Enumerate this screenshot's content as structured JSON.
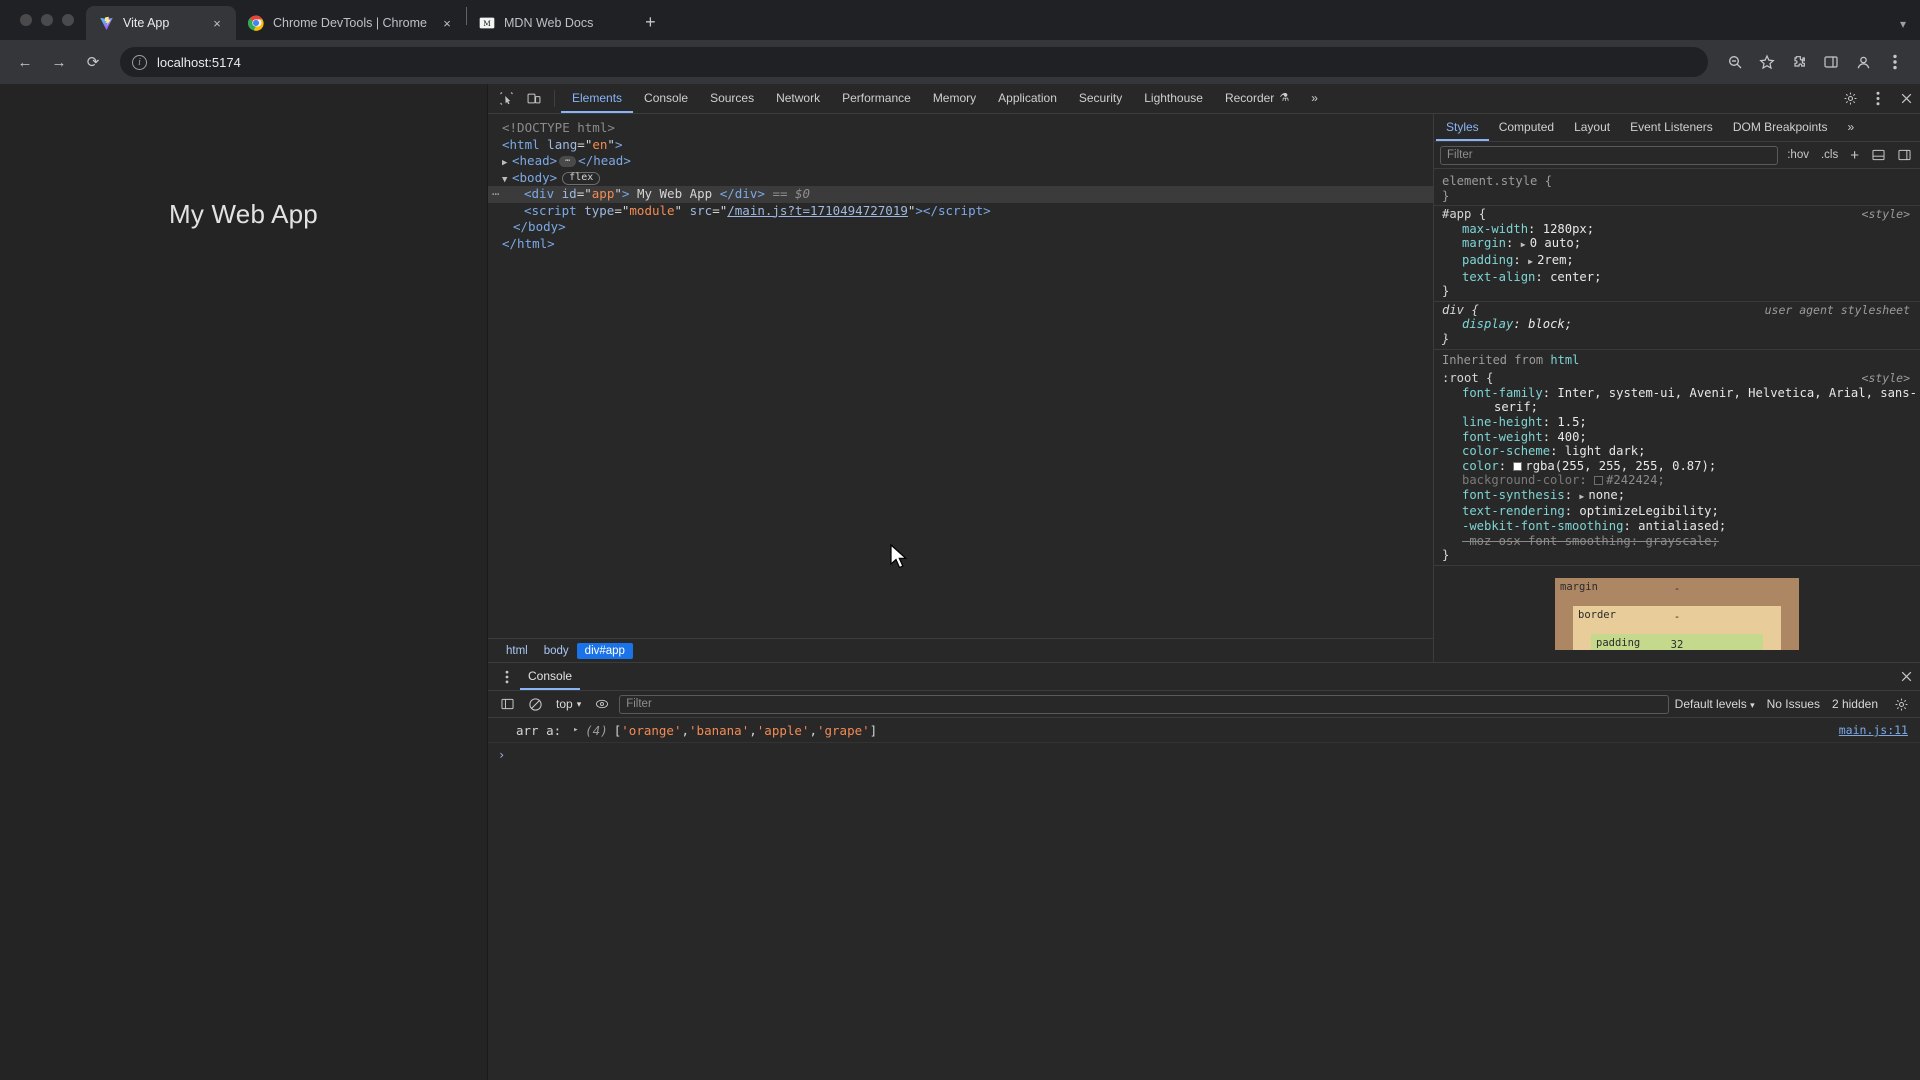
{
  "browser": {
    "tabs": [
      {
        "title": "Vite App",
        "favicon": "vite-logo-icon",
        "active": true,
        "close": "×"
      },
      {
        "title": "Chrome DevTools | Chrome f",
        "favicon": "chrome-logo-icon",
        "active": false,
        "close": "×"
      },
      {
        "title": "MDN Web Docs",
        "favicon": "mdn-logo-icon",
        "active": false,
        "close": ""
      }
    ],
    "new_tab_label": "+",
    "nav": {
      "back": "←",
      "forward": "→",
      "reload": "⟳"
    },
    "omnibox": {
      "value": "localhost:5174",
      "info_icon": "site-info-icon"
    },
    "toolbar_icons": [
      "zoom-icon",
      "bookmark-star-icon",
      "extensions-icon",
      "side-panel-icon",
      "profile-icon",
      "browser-menu-icon"
    ]
  },
  "page": {
    "heading": "My Web App"
  },
  "devtools": {
    "panel_tabs": [
      {
        "label": "Elements",
        "active": true
      },
      {
        "label": "Console",
        "active": false
      },
      {
        "label": "Sources",
        "active": false
      },
      {
        "label": "Network",
        "active": false
      },
      {
        "label": "Performance",
        "active": false
      },
      {
        "label": "Memory",
        "active": false
      },
      {
        "label": "Application",
        "active": false
      },
      {
        "label": "Security",
        "active": false
      },
      {
        "label": "Lighthouse",
        "active": false
      },
      {
        "label": "Recorder",
        "active": false,
        "suffix": "⚗"
      }
    ],
    "more_tabs": "»",
    "settings_icon": "gear-icon",
    "menu_icon": "kebab-menu-icon",
    "close_icon": "close-icon",
    "inspect_icon": "inspect-element-icon",
    "device_icon": "device-toolbar-icon",
    "dom": {
      "lines": [
        {
          "type": "doctype",
          "text": "<!DOCTYPE html>"
        },
        {
          "type": "html_open",
          "tag": "html",
          "attr": "lang",
          "value": "en"
        },
        {
          "type": "head",
          "tag": "head"
        },
        {
          "type": "body",
          "tag": "body",
          "badge": "flex"
        },
        {
          "type": "div_app",
          "tag": "div",
          "attr": "id",
          "value": "app",
          "text": "My Web App",
          "suffix": "== $0",
          "selected": true
        },
        {
          "type": "script",
          "tag": "script",
          "attr1": "type",
          "value1": "module",
          "attr2": "src",
          "value2": "/main.js?t=1710494727019"
        },
        {
          "type": "close",
          "text": "</body>"
        },
        {
          "type": "close",
          "text": "</html>"
        }
      ]
    },
    "breadcrumb": [
      {
        "label": "html",
        "active": false
      },
      {
        "label": "body",
        "active": false
      },
      {
        "label": "div#app",
        "active": true
      }
    ],
    "styles": {
      "tabs": [
        {
          "label": "Styles",
          "active": true
        },
        {
          "label": "Computed",
          "active": false
        },
        {
          "label": "Layout",
          "active": false
        },
        {
          "label": "Event Listeners",
          "active": false
        },
        {
          "label": "DOM Breakpoints",
          "active": false
        }
      ],
      "more_tabs": "»",
      "filter_placeholder": "Filter",
      "hov_label": ":hov",
      "cls_label": ".cls",
      "new_rule_label": "+",
      "toggle_icons": [
        "element-classes-icon",
        "computed-sidebar-icon"
      ],
      "rules": [
        {
          "selector": "element.style",
          "dimmed": true,
          "origin": "",
          "props": []
        },
        {
          "selector": "#app",
          "origin": "<style>",
          "props": [
            {
              "name": "max-width",
              "value": "1280px"
            },
            {
              "name": "margin",
              "value": "0 auto",
              "expandable": true
            },
            {
              "name": "padding",
              "value": "2rem",
              "expandable": true
            },
            {
              "name": "text-align",
              "value": "center"
            }
          ]
        },
        {
          "selector": "div",
          "origin": "user agent stylesheet",
          "ua": true,
          "props": [
            {
              "name": "display",
              "value": "block"
            }
          ]
        }
      ],
      "inherited_label": "Inherited from",
      "inherited_from": "html",
      "root_rule": {
        "selector": ":root",
        "origin": "<style>",
        "props": [
          {
            "name": "font-family",
            "value": "Inter, system-ui, Avenir, Helvetica, Arial, sans-",
            "cont": "serif;"
          },
          {
            "name": "line-height",
            "value": "1.5"
          },
          {
            "name": "font-weight",
            "value": "400"
          },
          {
            "name": "color-scheme",
            "value": "light dark"
          },
          {
            "name": "color",
            "value": "rgba(255, 255, 255, 0.87)",
            "swatch": "#ffffff"
          },
          {
            "name": "background-color",
            "value": "#242424",
            "swatch": "#242424",
            "dimmed": true
          },
          {
            "name": "font-synthesis",
            "value": "none",
            "expandable": true
          },
          {
            "name": "text-rendering",
            "value": "optimizeLegibility"
          },
          {
            "name": "-webkit-font-smoothing",
            "value": "antialiased"
          },
          {
            "name": "-moz-osx-font-smoothing",
            "value": "grayscale",
            "strike": true
          }
        ]
      },
      "box_model": {
        "margin_label": "margin",
        "margin_value": "-",
        "border_label": "border",
        "border_value": "-",
        "padding_label": "padding",
        "padding_value": "32"
      }
    },
    "drawer": {
      "tab_label": "Console",
      "close_icon": "close-icon",
      "kebab_icon": "kebab-menu-icon",
      "toolbar": {
        "sidebar_icon": "console-sidebar-icon",
        "clear_icon": "clear-console-icon",
        "context": "top",
        "context_caret": "▾",
        "eye_icon": "live-expression-icon",
        "filter_placeholder": "Filter",
        "levels": "Default levels",
        "levels_caret": "▾",
        "issues": "No Issues",
        "hidden": "2 hidden",
        "settings_icon": "gear-icon"
      },
      "messages": [
        {
          "label": "arr a:",
          "expand_caret": "▸",
          "count": "(4)",
          "items": [
            "'orange'",
            "'banana'",
            "'apple'",
            "'grape'"
          ],
          "source": "main.js:11"
        }
      ],
      "prompt_caret": "›"
    }
  }
}
